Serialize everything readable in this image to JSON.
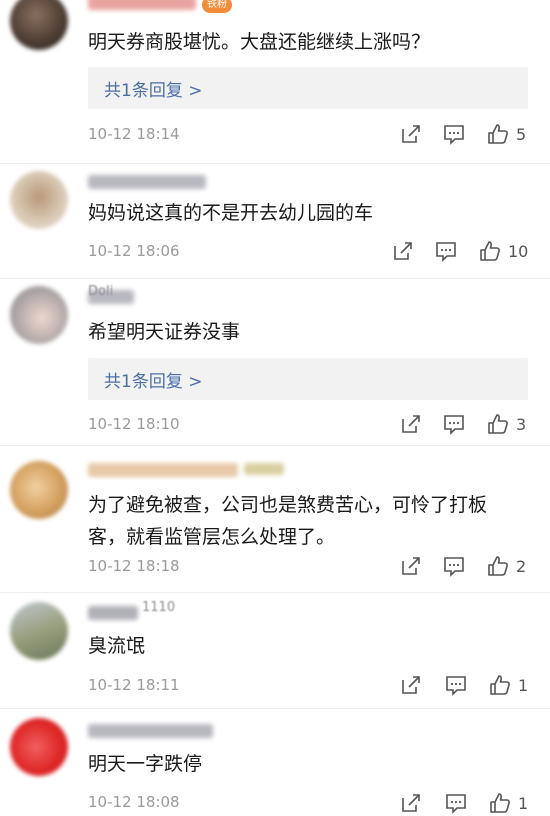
{
  "comments": [
    {
      "text": "明天券商股堪忧。大盘还能继续上涨吗？",
      "badge": "铁粉",
      "reply_label": "共1条回复 >",
      "time": "10-12 18:14",
      "likes": "5",
      "avatar_colors": [
        "#4a3a30",
        "#8a7060"
      ],
      "nick_color": "#e9a4a0"
    },
    {
      "text": "妈妈说这真的不是开去幼儿园的车",
      "time": "10-12 18:06",
      "likes": "10",
      "avatar_colors": [
        "#d8c8b4",
        "#b89878"
      ],
      "nick_color": "#b8b8c0"
    },
    {
      "nick": "Doli",
      "text": "希望明天证券没事",
      "reply_label": "共1条回复 >",
      "time": "10-12 18:10",
      "likes": "3",
      "avatar_colors": [
        "#a0a0a0",
        "#f0d8d0"
      ],
      "nick_color": "#b8b8c0"
    },
    {
      "text_line1": "为了避免被查，公司也是煞费苦心，可怜了打板",
      "text_line2": "客，就看监管层怎么处理了。",
      "time": "10-12 18:18",
      "likes": "2",
      "avatar_colors": [
        "#d4a060",
        "#f0d0a0"
      ],
      "nick_color": "#e8c9a8"
    },
    {
      "nick": "1110",
      "text": "臭流氓",
      "time": "10-12 18:11",
      "likes": "1",
      "avatar_colors": [
        "#8a9a70",
        "#c0c8d0"
      ],
      "nick_color": "#b0b0b8"
    },
    {
      "text": "明天一字跌停",
      "time": "10-12 18:08",
      "likes": "1",
      "avatar_colors": [
        "#e02828",
        "#f06060"
      ],
      "nick_color": "#b8b8c0"
    }
  ]
}
